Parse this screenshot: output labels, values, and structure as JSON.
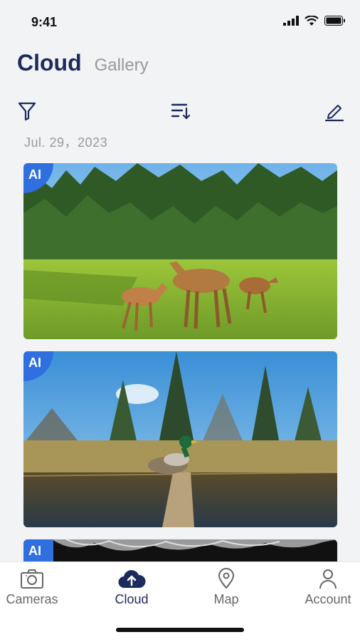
{
  "status": {
    "time": "9:41"
  },
  "header": {
    "title": "Cloud",
    "tab_gallery": "Gallery"
  },
  "toolbar": {
    "filter_icon": "filter-icon",
    "sort_icon": "sort-icon",
    "edit_icon": "edit-icon"
  },
  "date": "Jul. 29，2023",
  "photos": [
    {
      "badge": "AI",
      "subject": "deer-in-meadow"
    },
    {
      "badge": "AI",
      "subject": "duck-on-log"
    },
    {
      "badge": "AI",
      "subject": "night-canopy"
    }
  ],
  "tabbar": {
    "items": [
      {
        "label": "Cameras",
        "icon": "camera-icon"
      },
      {
        "label": "Cloud",
        "icon": "cloud-upload-icon",
        "active": true
      },
      {
        "label": "Map",
        "icon": "map-pin-icon"
      },
      {
        "label": "Account",
        "icon": "user-icon"
      }
    ]
  },
  "colors": {
    "accent": "#1c2a5e",
    "badge": "#2f6fe0",
    "background": "#f2f3f5"
  }
}
